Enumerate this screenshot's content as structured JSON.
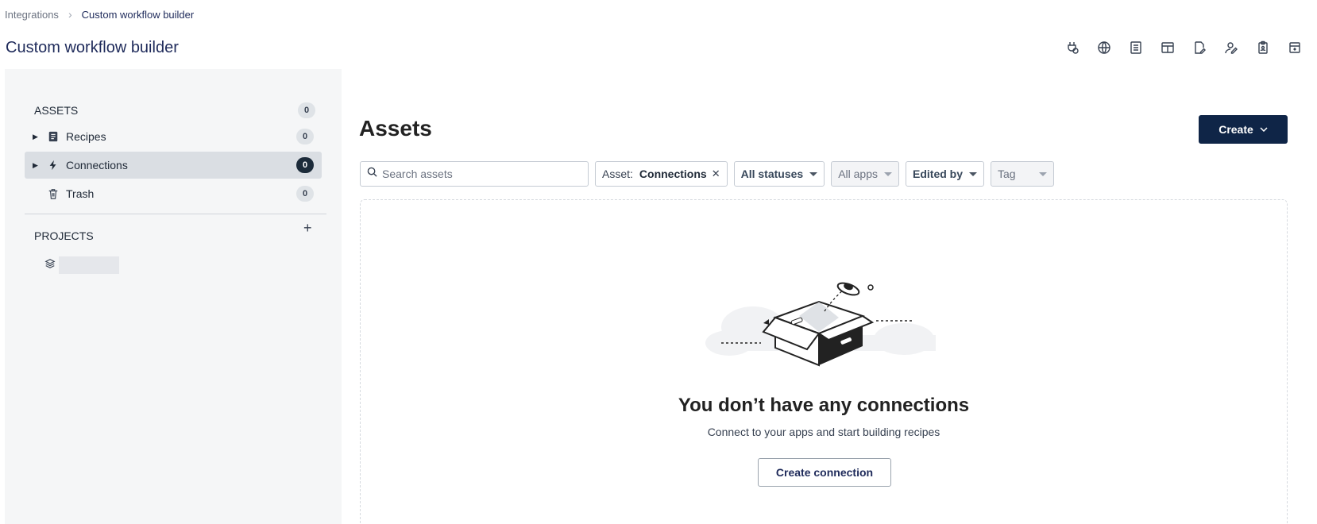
{
  "breadcrumb": {
    "root": "Integrations",
    "current": "Custom workflow builder"
  },
  "page_title": "Custom workflow builder",
  "header_icons": [
    "plug-icon",
    "globe-icon",
    "list-icon",
    "table-icon",
    "file-edit-icon",
    "user-edit-icon",
    "clipboard-icon",
    "archive-icon"
  ],
  "sidebar": {
    "assets_label": "ASSETS",
    "assets_count": "0",
    "items": [
      {
        "label": "Recipes",
        "count": "0",
        "icon": "recipe-icon"
      },
      {
        "label": "Connections",
        "count": "0",
        "icon": "lightning-icon"
      },
      {
        "label": "Trash",
        "count": "0",
        "icon": "trash-icon"
      }
    ],
    "projects_label": "PROJECTS",
    "add_project": "+"
  },
  "main": {
    "title": "Assets",
    "create_label": "Create",
    "search_placeholder": "Search assets",
    "filters": {
      "asset_prefix": "Asset:",
      "asset_value": "Connections",
      "status": "All statuses",
      "apps": "All apps",
      "edited_by": "Edited by",
      "tag": "Tag"
    },
    "empty_title": "You don’t have any connections",
    "empty_sub": "Connect to your apps and start building recipes",
    "empty_button": "Create connection"
  },
  "colors": {
    "primary": "#0f2547",
    "title": "#1e2a5a",
    "sidebar_bg": "#f5f6f7"
  }
}
